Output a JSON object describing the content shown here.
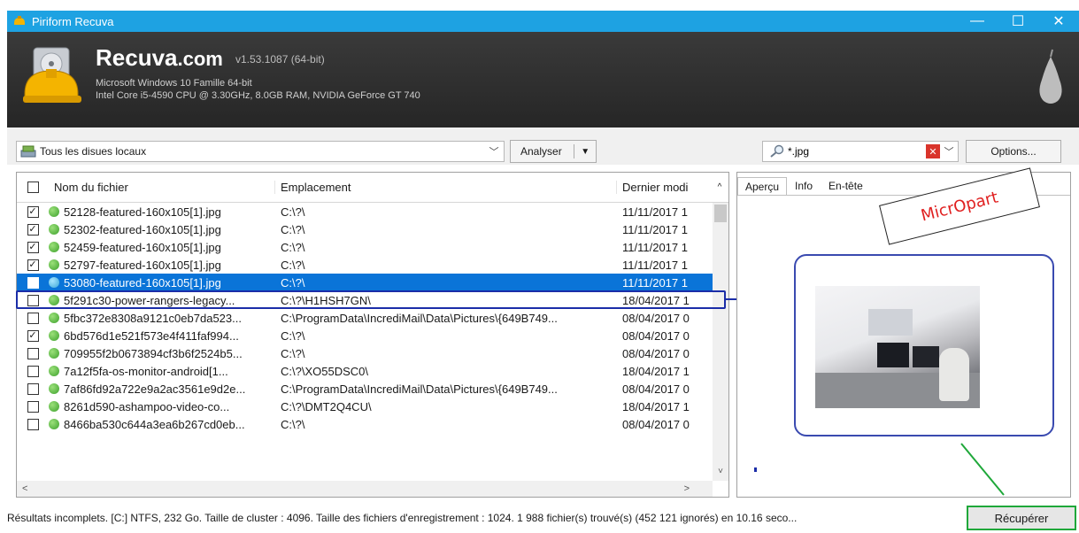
{
  "window": {
    "title": "Piriform Recuva",
    "controls": {
      "minimize": "—",
      "maximize": "☐",
      "close": "✕"
    }
  },
  "header": {
    "brand": "Recuva",
    "brand_suffix": ".com",
    "version": "v1.53.1087 (64-bit)",
    "os": "Microsoft Windows 10 Famille 64-bit",
    "hardware": "Intel Core i5-4590 CPU @ 3.30GHz, 8.0GB RAM, NVIDIA GeForce GT 740"
  },
  "toolbar": {
    "drive_label": "Tous les disues locaux",
    "analyse_label": "Analyser",
    "filter_value": "*.jpg",
    "options_label": "Options..."
  },
  "list": {
    "columns": {
      "name": "Nom du fichier",
      "path": "Emplacement",
      "date": "Dernier modi"
    },
    "rows": [
      {
        "checked": true,
        "selected": false,
        "name": "52128-featured-160x105[1].jpg",
        "path": "C:\\?\\",
        "date": "11/11/2017 1"
      },
      {
        "checked": true,
        "selected": false,
        "name": "52302-featured-160x105[1].jpg",
        "path": "C:\\?\\",
        "date": "11/11/2017 1"
      },
      {
        "checked": true,
        "selected": false,
        "name": "52459-featured-160x105[1].jpg",
        "path": "C:\\?\\",
        "date": "11/11/2017 1"
      },
      {
        "checked": true,
        "selected": false,
        "name": "52797-featured-160x105[1].jpg",
        "path": "C:\\?\\",
        "date": "11/11/2017 1"
      },
      {
        "checked": true,
        "selected": true,
        "name": "53080-featured-160x105[1].jpg",
        "path": "C:\\?\\",
        "date": "11/11/2017 1"
      },
      {
        "checked": false,
        "selected": false,
        "name": "5f291c30-power-rangers-legacy...",
        "path": "C:\\?\\H1HSH7GN\\",
        "date": "18/04/2017 1"
      },
      {
        "checked": false,
        "selected": false,
        "name": "5fbc372e8308a9121c0eb7da523...",
        "path": "C:\\ProgramData\\IncrediMail\\Data\\Pictures\\{649B749...",
        "date": "08/04/2017 0"
      },
      {
        "checked": true,
        "selected": false,
        "name": "6bd576d1e521f573e4f411faf994...",
        "path": "C:\\?\\",
        "date": "08/04/2017 0"
      },
      {
        "checked": false,
        "selected": false,
        "name": "709955f2b0673894cf3b6f2524b5...",
        "path": "C:\\?\\",
        "date": "08/04/2017 0"
      },
      {
        "checked": false,
        "selected": false,
        "name": "7a12f5fa-os-monitor-android[1...",
        "path": "C:\\?\\XO55DSC0\\",
        "date": "18/04/2017 1"
      },
      {
        "checked": false,
        "selected": false,
        "name": "7af86fd92a722e9a2ac3561e9d2e...",
        "path": "C:\\ProgramData\\IncrediMail\\Data\\Pictures\\{649B749...",
        "date": "08/04/2017 0"
      },
      {
        "checked": false,
        "selected": false,
        "name": "8261d590-ashampoo-video-co...",
        "path": "C:\\?\\DMT2Q4CU\\",
        "date": "18/04/2017 1"
      },
      {
        "checked": false,
        "selected": false,
        "name": "8466ba530c644a3ea6b267cd0eb...",
        "path": "C:\\?\\",
        "date": "08/04/2017 0"
      }
    ]
  },
  "preview": {
    "tabs": [
      "Aperçu",
      "Info",
      "En-tête"
    ],
    "active_tab": "Aperçu"
  },
  "watermark": "MicrOpart",
  "status": {
    "text": "Résultats incomplets. [C:] NTFS, 232 Go. Taille de cluster : 4096. Taille des fichiers d'enregistrement : 1024. 1 988 fichier(s) trouvé(s) (452 121 ignorés) en 10.16 seco...",
    "recover_label": "Récupérer"
  },
  "colors": {
    "titlebar": "#1ea2e2",
    "selection": "#0a74d8",
    "annotation_blue": "#1b2da8",
    "annotation_green": "#1fa83a",
    "watermark_text": "#e02020"
  }
}
